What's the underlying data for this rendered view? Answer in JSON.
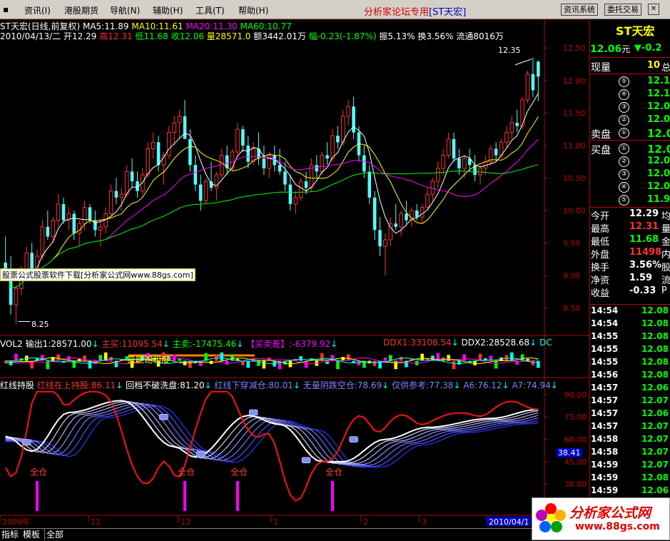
{
  "menu": {
    "items": [
      "资讯(I)",
      "港股期货",
      "导航(N)",
      "辅助(H)",
      "工具(T)",
      "帮助(H)"
    ],
    "forum": "分析家论坛专用",
    "stock_tag": "[ST天宏]",
    "buttons": [
      "资讯系统",
      "委托交易"
    ]
  },
  "main": {
    "title": "ST天宏(日线,前复权)",
    "ma": [
      {
        "label": "MA5:11.89",
        "color": "#ffffff"
      },
      {
        "label": "MA10:11.61",
        "color": "#ffff00"
      },
      {
        "label": "MA20:11.30",
        "color": "#ff00ff"
      },
      {
        "label": "MA60:10.77",
        "color": "#00ff00"
      }
    ],
    "info_date": "2010/04/13/二",
    "open_label": "开12.29",
    "high_label": "高12.31",
    "low_label": "低11.68",
    "close_label": "收12.06",
    "vol_label": "量28571.0",
    "amount_label": "额3442.01万",
    "change_label": "幅-0.23(-1.87%)",
    "amp_label": "振5.13%",
    "turnover_label": "换3.56%",
    "float_label": "流通8016万",
    "high_marker": "12.35",
    "low_marker": "8.25",
    "watermark": "股票公式股票软件下载[分析家公式网www.88gs.com]"
  },
  "vol_panel": {
    "title": "VOL2",
    "output": "输出1:28571.00",
    "main_buy": "主买:11095.54",
    "main_sell": "主卖:-17475.46",
    "buy_sell_diff": "【买卖差】:-6379.92",
    "ddx1": "DDX1:33108.54",
    "ddx2": "DDX2:28528.68",
    "dc": "DC",
    "band_label": "量能饱和度"
  },
  "ind_panel": {
    "title": "红线持股",
    "items": [
      {
        "label": "红线在上持股:86.11",
        "color": "#ff3030"
      },
      {
        "label": "回档不破洗盘:81.20",
        "color": "#ffffff"
      },
      {
        "label": "红线下穿减仓:80.01",
        "color": "#8080ff"
      },
      {
        "label": "无量阴跌空仓:78.69",
        "color": "#8080ff"
      },
      {
        "label": "仅供参考:77.38",
        "color": "#8080ff"
      },
      {
        "label": "A6:76.12",
        "color": "#8080ff"
      },
      {
        "label": "A7:74.94",
        "color": "#8080ff"
      }
    ],
    "signal_label": "全仓",
    "current_value": "38.41"
  },
  "time_axis": {
    "labels": [
      "2009年",
      "11",
      "12",
      "1",
      "2",
      "3",
      "2010/04/1"
    ]
  },
  "bottom_tabs": [
    "指标",
    "模板",
    "全部"
  ],
  "right_panel": {
    "stock_name": "ST天宏",
    "price": "12.06",
    "price_unit": "元",
    "change": "▼-0.2",
    "volume_label": "现量",
    "volume_value": "10",
    "volume_suffix": "总",
    "sell_label": "卖盘",
    "buy_label": "买盘",
    "sell_levels": [
      {
        "level": "⑤",
        "price": "12.1"
      },
      {
        "level": "④",
        "price": "12.1"
      },
      {
        "level": "③",
        "price": "12.0"
      },
      {
        "level": "②",
        "price": "12.0"
      },
      {
        "level": "①",
        "price": "12.0"
      }
    ],
    "buy_levels": [
      {
        "level": "①",
        "price": "12.0"
      },
      {
        "level": "②",
        "price": "12.0"
      },
      {
        "level": "③",
        "price": "12.0"
      },
      {
        "level": "④",
        "price": "12.0"
      },
      {
        "level": "⑤",
        "price": "11.9"
      }
    ],
    "stats": [
      {
        "label": "今开",
        "value": "12.29",
        "color": "#ffffff",
        "suffix": "均"
      },
      {
        "label": "最高",
        "value": "12.31",
        "color": "#ff3030",
        "suffix": "量"
      },
      {
        "label": "最低",
        "value": "11.68",
        "color": "#00ff00",
        "suffix": "金"
      },
      {
        "label": "外盘",
        "value": "11498",
        "color": "#ff3030",
        "suffix": "内"
      },
      {
        "label": "换手",
        "value": "3.56%",
        "color": "#ffffff",
        "suffix": "股"
      },
      {
        "label": "净资",
        "value": "1.59",
        "color": "#ffffff",
        "suffix": "流"
      },
      {
        "label": "收益",
        "value": "-0.33",
        "color": "#ffffff",
        "suffix": "P"
      }
    ],
    "ticks": [
      {
        "time": "14:54",
        "price": "12.08"
      },
      {
        "time": "14:54",
        "price": "12.08"
      },
      {
        "time": "14:55",
        "price": "12.08"
      },
      {
        "time": "14:55",
        "price": "12.08"
      },
      {
        "time": "14:55",
        "price": "12.08"
      },
      {
        "time": "14:56",
        "price": "12.08"
      },
      {
        "time": "14:57",
        "price": "12.06"
      },
      {
        "time": "14:57",
        "price": "12.07"
      },
      {
        "time": "14:57",
        "price": "12.06"
      },
      {
        "time": "14:57",
        "price": "12.07"
      },
      {
        "time": "14:58",
        "price": "12.07"
      },
      {
        "time": "14:58",
        "price": "12.07"
      },
      {
        "time": "14:59",
        "price": "12.07"
      },
      {
        "time": "14:59",
        "price": "12.08"
      },
      {
        "time": "14:59",
        "price": "12.06"
      }
    ]
  },
  "logo": {
    "text": "分析家公式网",
    "url": "www.88gs.com"
  },
  "chart_data": [
    {
      "type": "candlestick",
      "y_ticks": [
        12.5,
        12.0,
        11.5,
        11.0,
        10.5,
        10.0,
        9.5,
        9.0,
        8.5
      ],
      "ylim": [
        8.2,
        12.7
      ],
      "candles": [
        {
          "o": 9.2,
          "h": 9.6,
          "l": 8.95,
          "c": 9.1
        },
        {
          "o": 9.1,
          "h": 9.3,
          "l": 8.4,
          "c": 8.55
        },
        {
          "o": 8.55,
          "h": 8.85,
          "l": 8.25,
          "c": 8.8
        },
        {
          "o": 8.8,
          "h": 9.15,
          "l": 8.7,
          "c": 9.05
        },
        {
          "o": 9.05,
          "h": 9.45,
          "l": 8.95,
          "c": 9.35
        },
        {
          "o": 9.35,
          "h": 9.5,
          "l": 9.05,
          "c": 9.1
        },
        {
          "o": 9.1,
          "h": 9.4,
          "l": 8.95,
          "c": 9.3
        },
        {
          "o": 9.3,
          "h": 9.85,
          "l": 9.25,
          "c": 9.75
        },
        {
          "o": 9.75,
          "h": 10.0,
          "l": 9.55,
          "c": 9.6
        },
        {
          "o": 9.6,
          "h": 9.9,
          "l": 9.5,
          "c": 9.85
        },
        {
          "o": 9.85,
          "h": 10.25,
          "l": 9.75,
          "c": 10.1
        },
        {
          "o": 10.1,
          "h": 10.2,
          "l": 9.8,
          "c": 9.85
        },
        {
          "o": 9.85,
          "h": 10.05,
          "l": 9.7,
          "c": 9.95
        },
        {
          "o": 9.95,
          "h": 10.0,
          "l": 9.55,
          "c": 9.65
        },
        {
          "o": 9.65,
          "h": 9.85,
          "l": 9.45,
          "c": 9.8
        },
        {
          "o": 9.8,
          "h": 10.15,
          "l": 9.7,
          "c": 10.05
        },
        {
          "o": 10.05,
          "h": 10.1,
          "l": 9.8,
          "c": 9.85
        },
        {
          "o": 9.85,
          "h": 10.0,
          "l": 9.6,
          "c": 9.7
        },
        {
          "o": 9.7,
          "h": 9.85,
          "l": 9.45,
          "c": 9.75
        },
        {
          "o": 9.75,
          "h": 10.05,
          "l": 9.65,
          "c": 9.95
        },
        {
          "o": 9.95,
          "h": 10.4,
          "l": 9.9,
          "c": 10.3
        },
        {
          "o": 10.3,
          "h": 10.5,
          "l": 10.1,
          "c": 10.2
        },
        {
          "o": 10.2,
          "h": 10.35,
          "l": 10.0,
          "c": 10.25
        },
        {
          "o": 10.25,
          "h": 10.7,
          "l": 10.2,
          "c": 10.6
        },
        {
          "o": 10.6,
          "h": 10.8,
          "l": 10.35,
          "c": 10.45
        },
        {
          "o": 10.45,
          "h": 10.6,
          "l": 10.2,
          "c": 10.3
        },
        {
          "o": 10.3,
          "h": 10.65,
          "l": 10.25,
          "c": 10.55
        },
        {
          "o": 10.55,
          "h": 11.05,
          "l": 10.5,
          "c": 10.95
        },
        {
          "o": 10.95,
          "h": 11.2,
          "l": 10.8,
          "c": 11.05
        },
        {
          "o": 11.05,
          "h": 11.15,
          "l": 10.6,
          "c": 10.7
        },
        {
          "o": 10.7,
          "h": 10.9,
          "l": 10.4,
          "c": 10.85
        },
        {
          "o": 10.85,
          "h": 11.3,
          "l": 10.8,
          "c": 11.2
        },
        {
          "o": 11.2,
          "h": 11.45,
          "l": 11.0,
          "c": 11.35
        },
        {
          "o": 11.35,
          "h": 11.55,
          "l": 11.1,
          "c": 11.45
        },
        {
          "o": 11.45,
          "h": 11.7,
          "l": 11.3,
          "c": 11.1
        },
        {
          "o": 11.1,
          "h": 11.25,
          "l": 10.6,
          "c": 10.7
        },
        {
          "o": 10.7,
          "h": 10.85,
          "l": 10.3,
          "c": 10.4
        },
        {
          "o": 10.4,
          "h": 10.55,
          "l": 10.0,
          "c": 10.15
        },
        {
          "o": 10.15,
          "h": 10.5,
          "l": 10.1,
          "c": 10.45
        },
        {
          "o": 10.45,
          "h": 10.75,
          "l": 10.3,
          "c": 10.35
        },
        {
          "o": 10.35,
          "h": 10.6,
          "l": 10.15,
          "c": 10.55
        },
        {
          "o": 10.55,
          "h": 10.95,
          "l": 10.5,
          "c": 10.85
        },
        {
          "o": 10.85,
          "h": 11.0,
          "l": 10.55,
          "c": 10.65
        },
        {
          "o": 10.65,
          "h": 10.95,
          "l": 10.6,
          "c": 10.9
        },
        {
          "o": 10.9,
          "h": 11.35,
          "l": 10.85,
          "c": 11.25
        },
        {
          "o": 11.25,
          "h": 11.3,
          "l": 10.9,
          "c": 11.0
        },
        {
          "o": 11.0,
          "h": 11.15,
          "l": 10.65,
          "c": 10.75
        },
        {
          "o": 10.75,
          "h": 11.05,
          "l": 10.7,
          "c": 10.95
        },
        {
          "o": 10.95,
          "h": 11.2,
          "l": 10.7,
          "c": 10.8
        },
        {
          "o": 10.8,
          "h": 11.0,
          "l": 10.55,
          "c": 10.65
        },
        {
          "o": 10.65,
          "h": 10.9,
          "l": 10.5,
          "c": 10.85
        },
        {
          "o": 10.85,
          "h": 11.0,
          "l": 10.6,
          "c": 10.7
        },
        {
          "o": 10.7,
          "h": 10.95,
          "l": 10.55,
          "c": 10.6
        },
        {
          "o": 10.6,
          "h": 10.75,
          "l": 10.3,
          "c": 10.4
        },
        {
          "o": 10.4,
          "h": 10.55,
          "l": 10.0,
          "c": 10.1
        },
        {
          "o": 10.1,
          "h": 10.3,
          "l": 9.95,
          "c": 10.2
        },
        {
          "o": 10.2,
          "h": 10.5,
          "l": 10.15,
          "c": 10.45
        },
        {
          "o": 10.45,
          "h": 10.6,
          "l": 10.25,
          "c": 10.35
        },
        {
          "o": 10.35,
          "h": 10.8,
          "l": 10.3,
          "c": 10.7
        },
        {
          "o": 10.7,
          "h": 10.85,
          "l": 10.5,
          "c": 10.6
        },
        {
          "o": 10.6,
          "h": 10.9,
          "l": 10.55,
          "c": 10.85
        },
        {
          "o": 10.85,
          "h": 11.05,
          "l": 10.7,
          "c": 10.8
        },
        {
          "o": 10.8,
          "h": 11.25,
          "l": 10.75,
          "c": 11.15
        },
        {
          "o": 11.15,
          "h": 11.3,
          "l": 10.95,
          "c": 11.05
        },
        {
          "o": 11.05,
          "h": 11.55,
          "l": 11.0,
          "c": 11.45
        },
        {
          "o": 11.45,
          "h": 11.7,
          "l": 11.3,
          "c": 11.6
        },
        {
          "o": 11.6,
          "h": 11.75,
          "l": 11.1,
          "c": 11.2
        },
        {
          "o": 11.2,
          "h": 11.3,
          "l": 10.75,
          "c": 10.85
        },
        {
          "o": 10.85,
          "h": 11.0,
          "l": 10.5,
          "c": 10.6
        },
        {
          "o": 10.6,
          "h": 10.7,
          "l": 10.1,
          "c": 10.2
        },
        {
          "o": 10.2,
          "h": 10.3,
          "l": 9.55,
          "c": 9.7
        },
        {
          "o": 9.7,
          "h": 9.9,
          "l": 9.3,
          "c": 9.45
        },
        {
          "o": 9.45,
          "h": 9.65,
          "l": 9.0,
          "c": 9.55
        },
        {
          "o": 9.55,
          "h": 9.9,
          "l": 9.45,
          "c": 9.8
        },
        {
          "o": 9.8,
          "h": 10.1,
          "l": 9.7,
          "c": 9.75
        },
        {
          "o": 9.75,
          "h": 10.0,
          "l": 9.6,
          "c": 9.95
        },
        {
          "o": 9.95,
          "h": 10.15,
          "l": 9.8,
          "c": 9.85
        },
        {
          "o": 9.85,
          "h": 10.05,
          "l": 9.75,
          "c": 10.0
        },
        {
          "o": 10.0,
          "h": 10.1,
          "l": 9.85,
          "c": 9.9
        },
        {
          "o": 9.9,
          "h": 10.1,
          "l": 9.8,
          "c": 10.05
        },
        {
          "o": 10.05,
          "h": 10.35,
          "l": 10.0,
          "c": 10.25
        },
        {
          "o": 10.25,
          "h": 10.5,
          "l": 10.15,
          "c": 10.45
        },
        {
          "o": 10.45,
          "h": 10.75,
          "l": 10.35,
          "c": 10.65
        },
        {
          "o": 10.65,
          "h": 10.95,
          "l": 10.55,
          "c": 10.85
        },
        {
          "o": 10.85,
          "h": 11.2,
          "l": 10.8,
          "c": 11.1
        },
        {
          "o": 11.1,
          "h": 11.2,
          "l": 10.75,
          "c": 10.8
        },
        {
          "o": 10.8,
          "h": 10.95,
          "l": 10.55,
          "c": 10.65
        },
        {
          "o": 10.65,
          "h": 10.85,
          "l": 10.5,
          "c": 10.8
        },
        {
          "o": 10.8,
          "h": 10.95,
          "l": 10.6,
          "c": 10.7
        },
        {
          "o": 10.7,
          "h": 10.85,
          "l": 10.45,
          "c": 10.55
        },
        {
          "o": 10.55,
          "h": 10.7,
          "l": 10.4,
          "c": 10.65
        },
        {
          "o": 10.65,
          "h": 10.85,
          "l": 10.55,
          "c": 10.75
        },
        {
          "o": 10.75,
          "h": 11.0,
          "l": 10.7,
          "c": 10.95
        },
        {
          "o": 10.95,
          "h": 11.05,
          "l": 10.75,
          "c": 10.85
        },
        {
          "o": 10.85,
          "h": 11.1,
          "l": 10.8,
          "c": 11.05
        },
        {
          "o": 11.05,
          "h": 11.3,
          "l": 10.95,
          "c": 11.2
        },
        {
          "o": 11.2,
          "h": 11.45,
          "l": 11.1,
          "c": 11.35
        },
        {
          "o": 11.35,
          "h": 11.55,
          "l": 11.2,
          "c": 11.3
        },
        {
          "o": 11.3,
          "h": 11.75,
          "l": 11.25,
          "c": 11.7
        },
        {
          "o": 11.7,
          "h": 12.15,
          "l": 11.65,
          "c": 12.1
        },
        {
          "o": 12.1,
          "h": 12.35,
          "l": 11.75,
          "c": 11.85
        },
        {
          "o": 12.29,
          "h": 12.31,
          "l": 11.68,
          "c": 12.06
        }
      ]
    },
    {
      "type": "bar",
      "name": "VOL2",
      "note_values": [
        28571.0,
        11095.54,
        -17475.46,
        -6379.92,
        33108.54,
        28528.68
      ]
    },
    {
      "type": "line",
      "ylim": [
        10,
        100
      ],
      "y_ticks": [
        90,
        75,
        60,
        45,
        30,
        15
      ],
      "signal_positions": [
        6,
        34,
        44,
        62
      ]
    }
  ]
}
